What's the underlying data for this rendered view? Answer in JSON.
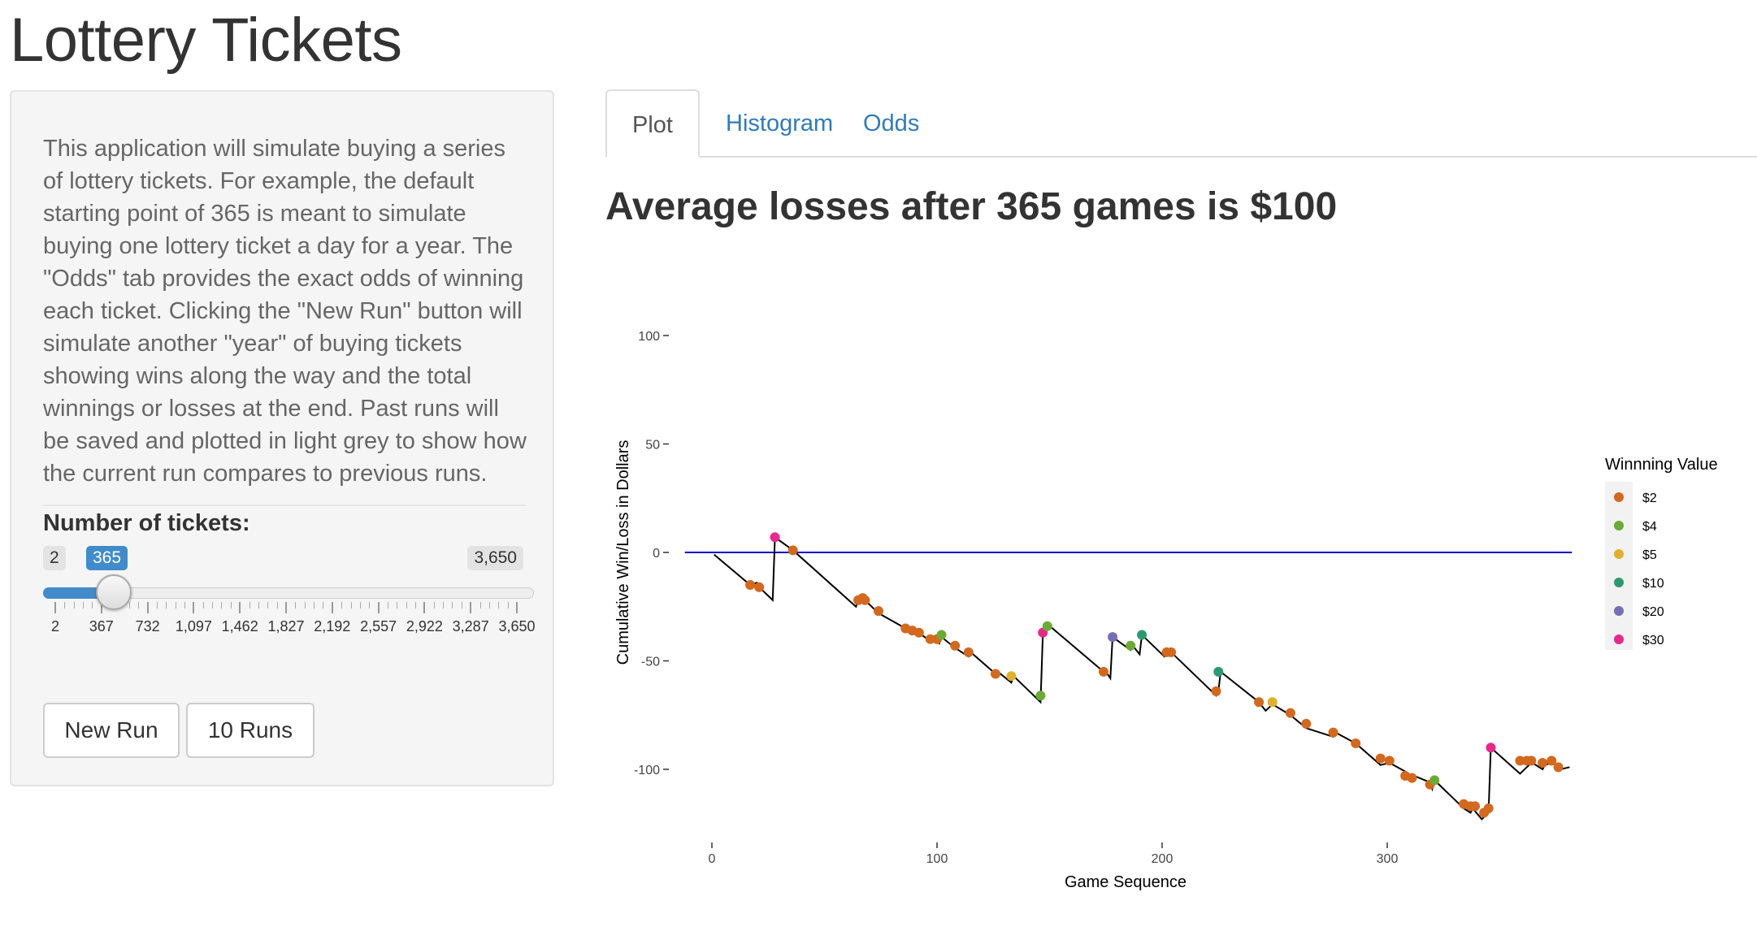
{
  "app": {
    "title": "Lottery Tickets"
  },
  "sidebar": {
    "description": "This application will simulate buying a series of lottery tickets. For example, the default starting point of 365 is meant to simulate buying one lottery ticket a day for a year. The \"Odds\" tab provides the exact odds of winning each ticket. Clicking the \"New Run\" button will simulate another \"year\" of buying tickets showing wins along the way and the total winnings or losses at the end. Past runs will be saved and plotted in light grey to show how the current run compares to previous runs.",
    "slider": {
      "label": "Number of tickets:",
      "min_label": "2",
      "max_label": "3,650",
      "value_label": "365",
      "min": 2,
      "max": 3650,
      "value": 365,
      "tick_labels": [
        "2",
        "367",
        "732",
        "1,097",
        "1,462",
        "1,827",
        "2,192",
        "2,557",
        "2,922",
        "3,287",
        "3,650"
      ]
    },
    "buttons": {
      "new_run": "New Run",
      "ten_runs": "10 Runs"
    }
  },
  "tabs": [
    {
      "label": "Plot",
      "active": true
    },
    {
      "label": "Histogram",
      "active": false
    },
    {
      "label": "Odds",
      "active": false
    }
  ],
  "plot": {
    "heading": "Average losses after 365 games is $100"
  },
  "chart_data": {
    "type": "line",
    "title": "",
    "xlabel": "Game Sequence",
    "ylabel": "Cumulative Win/Loss in Dollars",
    "xlim": [
      -15,
      382
    ],
    "ylim": [
      -123,
      103
    ],
    "x_ticks": [
      0,
      100,
      200,
      300
    ],
    "y_ticks": [
      100,
      50,
      0,
      -50,
      -100
    ],
    "reference_line": {
      "y": 0,
      "x_range": [
        -12,
        382
      ],
      "color": "#0000cc"
    },
    "grid": false,
    "line_color": "#000000",
    "legend": {
      "title": "Winnning Value",
      "position": "right",
      "entries": [
        {
          "label": "$2",
          "color": "#d2691e"
        },
        {
          "label": "$4",
          "color": "#6bab35"
        },
        {
          "label": "$5",
          "color": "#e0b030"
        },
        {
          "label": "$10",
          "color": "#2e9970"
        },
        {
          "label": "$20",
          "color": "#7570b3"
        },
        {
          "label": "$30",
          "color": "#e7298a"
        }
      ]
    },
    "line_points": [
      [
        1,
        -1
      ],
      [
        17,
        -15
      ],
      [
        20,
        -14
      ],
      [
        21,
        -16
      ],
      [
        27,
        -22
      ],
      [
        28,
        7
      ],
      [
        36,
        1
      ],
      [
        64,
        -25
      ],
      [
        65,
        -22
      ],
      [
        67,
        -23
      ],
      [
        68,
        -22
      ],
      [
        74,
        -28
      ],
      [
        86,
        -35
      ],
      [
        88,
        -35
      ],
      [
        89,
        -36
      ],
      [
        92,
        -37
      ],
      [
        97,
        -41
      ],
      [
        98,
        -40
      ],
      [
        101,
        -42
      ],
      [
        102,
        -39
      ],
      [
        108,
        -44
      ],
      [
        114,
        -48
      ],
      [
        115,
        -46
      ],
      [
        126,
        -56
      ],
      [
        127,
        -55
      ],
      [
        133,
        -60
      ],
      [
        134,
        -57
      ],
      [
        146,
        -69
      ],
      [
        147,
        -38
      ],
      [
        148,
        -36
      ],
      [
        149,
        -33
      ],
      [
        174,
        -55
      ],
      [
        175,
        -55
      ],
      [
        177,
        -58
      ],
      [
        178,
        -39
      ],
      [
        186,
        -45
      ],
      [
        187,
        -43
      ],
      [
        190,
        -47
      ],
      [
        191,
        -38
      ],
      [
        201,
        -48
      ],
      [
        202,
        -46
      ],
      [
        204,
        -46
      ],
      [
        224,
        -66
      ],
      [
        225,
        -64
      ],
      [
        226,
        -55
      ],
      [
        243,
        -69
      ],
      [
        246,
        -73
      ],
      [
        249,
        -70
      ],
      [
        257,
        -75
      ],
      [
        264,
        -81
      ],
      [
        276,
        -85
      ],
      [
        277,
        -83
      ],
      [
        286,
        -88
      ],
      [
        297,
        -98
      ],
      [
        301,
        -97
      ],
      [
        308,
        -101
      ],
      [
        309,
        -104
      ],
      [
        312,
        -103
      ],
      [
        319,
        -106
      ],
      [
        320,
        -109
      ],
      [
        321,
        -105
      ],
      [
        334,
        -118
      ],
      [
        337,
        -120
      ],
      [
        338,
        -118
      ],
      [
        342,
        -123
      ],
      [
        344,
        -121
      ],
      [
        345,
        -120
      ],
      [
        346,
        -90
      ],
      [
        359,
        -102
      ],
      [
        360,
        -101
      ],
      [
        364,
        -97
      ],
      [
        366,
        -98
      ],
      [
        369,
        -100
      ],
      [
        370,
        -98
      ],
      [
        373,
        -97
      ],
      [
        376,
        -98
      ],
      [
        377,
        -100
      ],
      [
        381,
        -99
      ]
    ],
    "win_points": [
      {
        "x": 28,
        "y": 7,
        "value": "$30"
      },
      {
        "x": 36,
        "y": 1,
        "value": "$2"
      },
      {
        "x": 17,
        "y": -15,
        "value": "$2"
      },
      {
        "x": 21,
        "y": -16,
        "value": "$2"
      },
      {
        "x": 65,
        "y": -22,
        "value": "$2"
      },
      {
        "x": 67,
        "y": -21,
        "value": "$2"
      },
      {
        "x": 68,
        "y": -22,
        "value": "$2"
      },
      {
        "x": 74,
        "y": -27,
        "value": "$2"
      },
      {
        "x": 86,
        "y": -35,
        "value": "$2"
      },
      {
        "x": 89,
        "y": -36,
        "value": "$2"
      },
      {
        "x": 92,
        "y": -37,
        "value": "$2"
      },
      {
        "x": 97,
        "y": -40,
        "value": "$2"
      },
      {
        "x": 100,
        "y": -40,
        "value": "$2"
      },
      {
        "x": 102,
        "y": -38,
        "value": "$4"
      },
      {
        "x": 108,
        "y": -43,
        "value": "$2"
      },
      {
        "x": 114,
        "y": -46,
        "value": "$2"
      },
      {
        "x": 126,
        "y": -56,
        "value": "$2"
      },
      {
        "x": 133,
        "y": -57,
        "value": "$5"
      },
      {
        "x": 146,
        "y": -66,
        "value": "$4"
      },
      {
        "x": 147,
        "y": -37,
        "value": "$30"
      },
      {
        "x": 149,
        "y": -34,
        "value": "$4"
      },
      {
        "x": 174,
        "y": -55,
        "value": "$2"
      },
      {
        "x": 178,
        "y": -39,
        "value": "$20"
      },
      {
        "x": 186,
        "y": -43,
        "value": "$4"
      },
      {
        "x": 191,
        "y": -38,
        "value": "$10"
      },
      {
        "x": 202,
        "y": -46,
        "value": "$2"
      },
      {
        "x": 204,
        "y": -46,
        "value": "$2"
      },
      {
        "x": 224,
        "y": -64,
        "value": "$2"
      },
      {
        "x": 225,
        "y": -55,
        "value": "$10"
      },
      {
        "x": 243,
        "y": -69,
        "value": "$2"
      },
      {
        "x": 249,
        "y": -69,
        "value": "$5"
      },
      {
        "x": 257,
        "y": -74,
        "value": "$2"
      },
      {
        "x": 264,
        "y": -79,
        "value": "$2"
      },
      {
        "x": 276,
        "y": -83,
        "value": "$2"
      },
      {
        "x": 286,
        "y": -88,
        "value": "$2"
      },
      {
        "x": 297,
        "y": -95,
        "value": "$2"
      },
      {
        "x": 301,
        "y": -96,
        "value": "$2"
      },
      {
        "x": 308,
        "y": -103,
        "value": "$2"
      },
      {
        "x": 311,
        "y": -104,
        "value": "$2"
      },
      {
        "x": 319,
        "y": -107,
        "value": "$2"
      },
      {
        "x": 321,
        "y": -105,
        "value": "$4"
      },
      {
        "x": 334,
        "y": -116,
        "value": "$2"
      },
      {
        "x": 337,
        "y": -117,
        "value": "$2"
      },
      {
        "x": 339,
        "y": -117,
        "value": "$2"
      },
      {
        "x": 343,
        "y": -120,
        "value": "$2"
      },
      {
        "x": 345,
        "y": -118,
        "value": "$2"
      },
      {
        "x": 346,
        "y": -90,
        "value": "$30"
      },
      {
        "x": 359,
        "y": -96,
        "value": "$2"
      },
      {
        "x": 362,
        "y": -96,
        "value": "$2"
      },
      {
        "x": 364,
        "y": -96,
        "value": "$2"
      },
      {
        "x": 369,
        "y": -97,
        "value": "$2"
      },
      {
        "x": 373,
        "y": -96,
        "value": "$2"
      },
      {
        "x": 376,
        "y": -99,
        "value": "$2"
      }
    ]
  }
}
